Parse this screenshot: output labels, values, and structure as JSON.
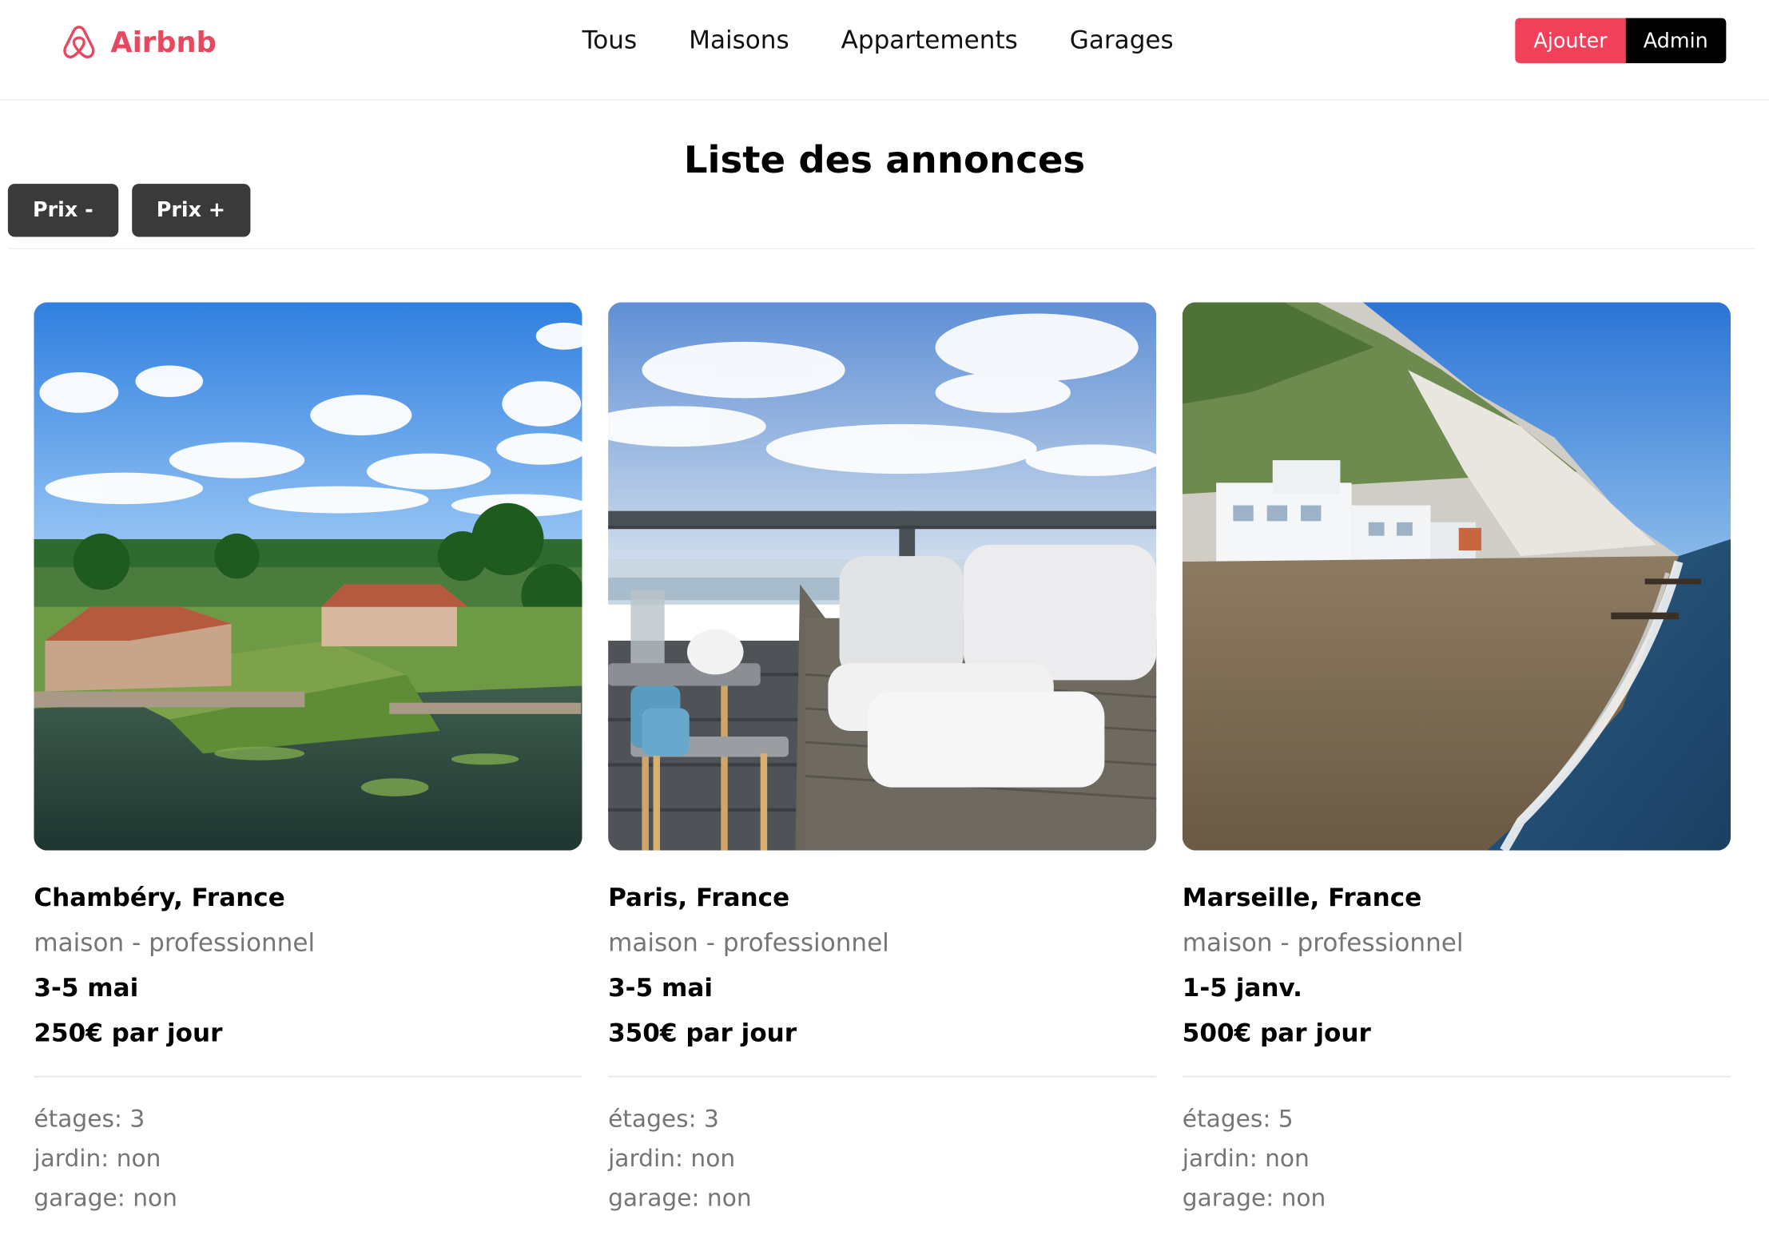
{
  "brand": {
    "name": "Airbnb",
    "color": "#e8485f"
  },
  "nav": {
    "items": [
      {
        "label": "Tous"
      },
      {
        "label": "Maisons"
      },
      {
        "label": "Appartements"
      },
      {
        "label": "Garages"
      }
    ]
  },
  "actions": {
    "add_label": "Ajouter",
    "admin_label": "Admin"
  },
  "page": {
    "title": "Liste des annonces"
  },
  "sort": {
    "price_down_label": "Prix -",
    "price_up_label": "Prix +"
  },
  "listings": [
    {
      "location": "Chambéry, France",
      "type": "maison - professionnel",
      "dates": "3-5 mai",
      "price": "250€ par jour",
      "specs": [
        "étages: 3",
        "jardin: non",
        "garage: non"
      ],
      "image": "countryside-house-by-water"
    },
    {
      "location": "Paris, France",
      "type": "maison - professionnel",
      "dates": "3-5 mai",
      "price": "350€ par jour",
      "specs": [
        "étages: 3",
        "jardin: non",
        "garage: non"
      ],
      "image": "balcony-with-sofa-sea-view"
    },
    {
      "location": "Marseille, France",
      "type": "maison - professionnel",
      "dates": "1-5 janv.",
      "price": "500€ par jour",
      "specs": [
        "étages: 5",
        "jardin: non",
        "garage: non"
      ],
      "image": "white-cliffs-beach-houses"
    }
  ],
  "colors": {
    "accent": "#f1405a",
    "dark_button": "#3a3a3a",
    "muted_text": "#757575"
  }
}
